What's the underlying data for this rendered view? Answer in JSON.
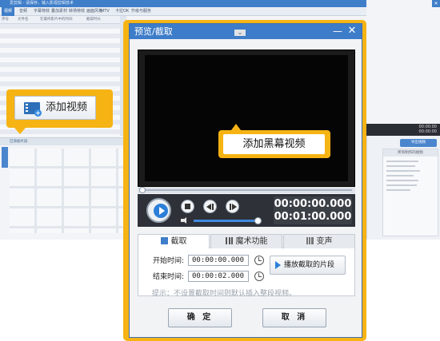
{
  "background_app": {
    "title": "爱剪辑 - 请保存，输入影视剪辑技术",
    "menu": [
      "视频",
      "音频",
      "字幕特效",
      "叠加素材",
      "转场特效",
      "画面风格",
      "MTV",
      "卡拉OK",
      "升级与服务"
    ],
    "header_cols": [
      "序号",
      "文件名",
      "在最终影片中的时间",
      "截取时长"
    ],
    "added_clips_label": "已添加片段",
    "timecodes": [
      "00:00:00",
      "00:00:00"
    ],
    "export_button": "导出视频",
    "panel_title": "所有制作的视频"
  },
  "add_video_button": {
    "label": "添加视频",
    "icon": "film-add-icon"
  },
  "dialog": {
    "title": "预览/截取",
    "minimize": "—",
    "close": "✕",
    "black_screen_button": "添加黑幕视频",
    "timecode_current": "00:00:00.000",
    "timecode_total": "00:01:00.000",
    "seek_progress": 0,
    "volume_level": 1,
    "tabs": [
      {
        "label": "截取",
        "active": true
      },
      {
        "label": "魔术功能",
        "active": false
      },
      {
        "label": "变声",
        "active": false
      }
    ],
    "start_time_label": "开始时间:",
    "start_time_value": "00:00:00.000",
    "end_time_label": "结束时间:",
    "end_time_value": "00:00:02.000",
    "play_segment_button": "播放截取的片段",
    "hint": "提示：不设置截取时间则默认插入整段视频。",
    "ok_button": "确 定",
    "cancel_button": "取 消"
  },
  "colors": {
    "accent_orange": "#f6b314",
    "title_blue": "#3d7cc8",
    "play_blue": "#2c7fd8"
  }
}
